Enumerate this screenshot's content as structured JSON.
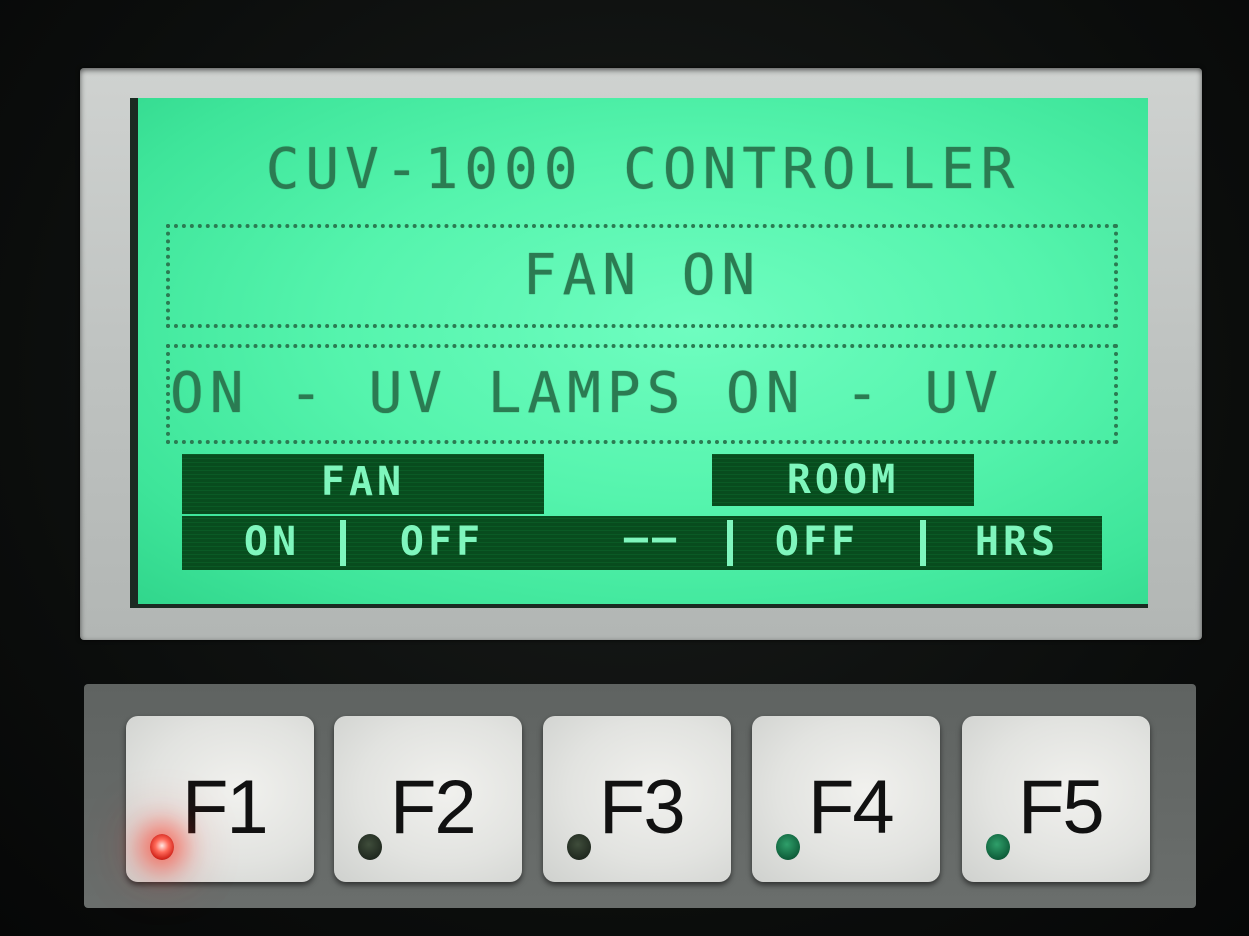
{
  "display": {
    "title": "CUV-1000 CONTROLLER",
    "fan_status": "FAN ON",
    "marquee": "ON - UV LAMPS ON - UV"
  },
  "softkeys": {
    "fan_header": "FAN",
    "room_header": "ROOM",
    "on_label": "ON",
    "off_label": "OFF",
    "dash_label": "——",
    "off2_label": "OFF",
    "hrs_label": "HRS"
  },
  "keys": [
    {
      "label": "F1",
      "led": "red-lit"
    },
    {
      "label": "F2",
      "led": "off"
    },
    {
      "label": "F3",
      "led": "off"
    },
    {
      "label": "F4",
      "led": "green-dim"
    },
    {
      "label": "F5",
      "led": "green-dim"
    }
  ],
  "colors": {
    "lcd_background": "#55f4ad",
    "lcd_text": "#2b7b52",
    "led_red": "#ff3c28",
    "led_green": "#0f5f3b"
  }
}
